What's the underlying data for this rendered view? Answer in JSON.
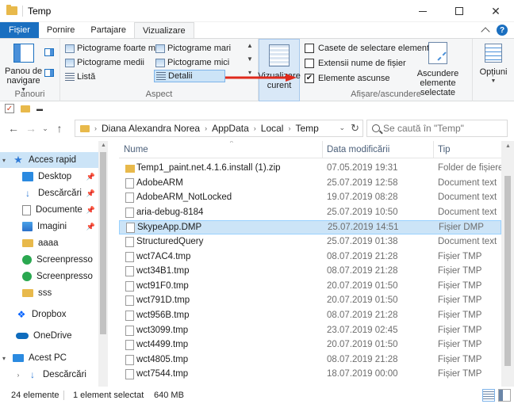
{
  "window": {
    "title": "Temp"
  },
  "tabs": [
    {
      "label": "Fișier"
    },
    {
      "label": "Pornire"
    },
    {
      "label": "Partajare"
    },
    {
      "label": "Vizualizare"
    }
  ],
  "ribbon": {
    "panes": {
      "navpane_line1": "Panou de",
      "navpane_line2": "navigare",
      "group_label": "Panouri"
    },
    "layout": {
      "items": [
        {
          "label": "Pictograme foarte mari"
        },
        {
          "label": "Pictograme mari"
        },
        {
          "label": "Pictograme medii"
        },
        {
          "label": "Pictograme mici"
        },
        {
          "label": "Listă"
        },
        {
          "label": "Detalii"
        }
      ],
      "group_label": "Aspect"
    },
    "current_view": {
      "line1": "Vizualizare",
      "line2": "curent"
    },
    "show_hide": {
      "checks": [
        {
          "label": "Casete de selectare element",
          "checked": false
        },
        {
          "label": "Extensii nume de fișier",
          "checked": false
        },
        {
          "label": "Elemente ascunse",
          "checked": true
        }
      ],
      "hide_line1": "Ascundere",
      "hide_line2": "elemente selectate",
      "group_label": "Afișare/ascundere"
    },
    "options": {
      "label": "Opțiuni"
    }
  },
  "address": {
    "crumbs": [
      "Diana Alexandra Norea",
      "AppData",
      "Local",
      "Temp"
    ]
  },
  "search": {
    "placeholder": "Se caută în \"Temp\""
  },
  "navpane": {
    "items": [
      {
        "label": "Acces rapid",
        "icon": "star-icon"
      },
      {
        "label": "Desktop",
        "icon": "desktop-icon"
      },
      {
        "label": "Descărcări",
        "icon": "download-icon"
      },
      {
        "label": "Documente",
        "icon": "documents-icon"
      },
      {
        "label": "Imagini",
        "icon": "pictures-icon"
      },
      {
        "label": "aaaa",
        "icon": "folder-icon"
      },
      {
        "label": "Screenpresso",
        "icon": "screenpresso-icon"
      },
      {
        "label": "Screenpresso",
        "icon": "screenpresso-icon"
      },
      {
        "label": "sss",
        "icon": "folder-icon"
      },
      {
        "label": "Dropbox",
        "icon": "dropbox-icon"
      },
      {
        "label": "OneDrive",
        "icon": "onedrive-icon"
      },
      {
        "label": "Acest PC",
        "icon": "pc-icon"
      },
      {
        "label": "Descărcări",
        "icon": "download-icon"
      }
    ]
  },
  "files": {
    "headers": {
      "name": "Nume",
      "date": "Data modificării",
      "type": "Tip"
    },
    "rows": [
      {
        "name": "Temp1_paint.net.4.1.6.install (1).zip",
        "date": "07.05.2019 19:31",
        "type": "Folder de fișiere",
        "zip": true
      },
      {
        "name": "AdobeARM",
        "date": "25.07.2019 12:58",
        "type": "Document text"
      },
      {
        "name": "AdobeARM_NotLocked",
        "date": "19.07.2019 08:28",
        "type": "Document text"
      },
      {
        "name": "aria-debug-8184",
        "date": "25.07.2019 10:50",
        "type": "Document text"
      },
      {
        "name": "SkypeApp.DMP",
        "date": "25.07.2019 14:51",
        "type": "Fișier DMP",
        "selected": true
      },
      {
        "name": "StructuredQuery",
        "date": "25.07.2019 01:38",
        "type": "Document text"
      },
      {
        "name": "wct7AC4.tmp",
        "date": "08.07.2019 21:28",
        "type": "Fișier TMP"
      },
      {
        "name": "wct34B1.tmp",
        "date": "08.07.2019 21:28",
        "type": "Fișier TMP"
      },
      {
        "name": "wct91F0.tmp",
        "date": "20.07.2019 01:50",
        "type": "Fișier TMP"
      },
      {
        "name": "wct791D.tmp",
        "date": "20.07.2019 01:50",
        "type": "Fișier TMP"
      },
      {
        "name": "wct956B.tmp",
        "date": "08.07.2019 21:28",
        "type": "Fișier TMP"
      },
      {
        "name": "wct3099.tmp",
        "date": "23.07.2019 02:45",
        "type": "Fișier TMP"
      },
      {
        "name": "wct4499.tmp",
        "date": "20.07.2019 01:50",
        "type": "Fișier TMP"
      },
      {
        "name": "wct4805.tmp",
        "date": "08.07.2019 21:28",
        "type": "Fișier TMP"
      },
      {
        "name": "wct7544.tmp",
        "date": "18.07.2019 00:00",
        "type": "Fișier TMP"
      }
    ]
  },
  "status": {
    "count": "24 elemente",
    "selection": "1 element selectat",
    "size": "640 MB"
  },
  "colors": {
    "accent": "#1a6fc0",
    "selection": "#cce4f7",
    "folder": "#e8b94b",
    "arrow": "#e02a1c"
  }
}
